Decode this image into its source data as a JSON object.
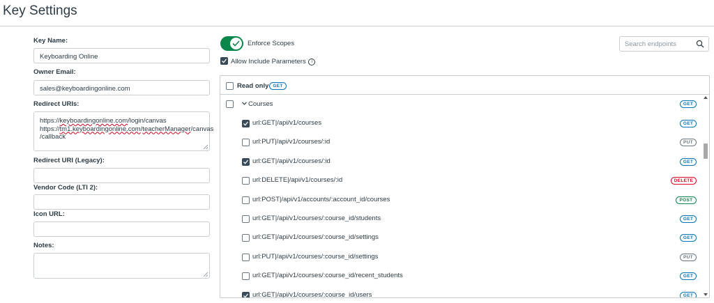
{
  "header": {
    "title": "Key Settings"
  },
  "form": {
    "key_name": {
      "label": "Key Name:",
      "value": "Keyboarding Online"
    },
    "owner_email": {
      "label": "Owner Email:",
      "value": "sales@keyboardingonline.com"
    },
    "redirect_uris": {
      "label": "Redirect URIs:",
      "line1": {
        "pre": "https://",
        "s1": "keyboardingonline.com",
        "post": "/login/canvas"
      },
      "line2": {
        "pre": "https://",
        "s1": "tm1.keyboardingonline.com",
        "mid": "/",
        "s2": "teacherManager",
        "post": "/canvas"
      },
      "line3": "/callback"
    },
    "redirect_uri_legacy": {
      "label": "Redirect URI (Legacy):",
      "value": ""
    },
    "vendor_code": {
      "label": "Vendor Code (LTI 2):",
      "value": ""
    },
    "icon_url": {
      "label": "Icon URL:",
      "value": ""
    },
    "notes": {
      "label": "Notes:",
      "value": ""
    }
  },
  "scopes": {
    "enforce_label": "Enforce Scopes",
    "enforce_on": true,
    "allow_include_label": "Allow Include Parameters",
    "allow_include_checked": true,
    "info_glyph": "i",
    "search_placeholder": "Search endpoints",
    "read_only_label": "Read only",
    "read_only_badge": "GET",
    "group": {
      "name": "Courses",
      "badge": "GET"
    },
    "endpoints": [
      {
        "label": "url:GET|/api/v1/courses",
        "method": "GET",
        "checked": true
      },
      {
        "label": "url:PUT|/api/v1/courses/:id",
        "method": "PUT",
        "checked": false
      },
      {
        "label": "url:GET|/api/v1/courses/:id",
        "method": "GET",
        "checked": true
      },
      {
        "label": "url:DELETE|/api/v1/courses/:id",
        "method": "DELETE",
        "checked": false
      },
      {
        "label": "url:POST|/api/v1/accounts/:account_id/courses",
        "method": "POST",
        "checked": false
      },
      {
        "label": "url:GET|/api/v1/courses/:course_id/students",
        "method": "GET",
        "checked": false
      },
      {
        "label": "url:GET|/api/v1/courses/:course_id/settings",
        "method": "GET",
        "checked": false
      },
      {
        "label": "url:PUT|/api/v1/courses/:course_id/settings",
        "method": "PUT",
        "checked": false
      },
      {
        "label": "url:GET|/api/v1/courses/:course_id/recent_students",
        "method": "GET",
        "checked": false
      },
      {
        "label": "url:GET|/api/v1/courses/:course_id/users",
        "method": "GET",
        "checked": true
      }
    ]
  },
  "colors": {
    "toggle_on": "#0b874b",
    "get": "#0374b5",
    "put": "#6b7780",
    "delete": "#e0061f",
    "post": "#0b874b",
    "checkbox_checked": "#394b58"
  },
  "icons": [
    "check-icon",
    "info-icon",
    "search-icon",
    "chevron-down-icon",
    "resize-grip-icon",
    "scroll-up-arrow-icon",
    "scroll-down-arrow-icon"
  ]
}
